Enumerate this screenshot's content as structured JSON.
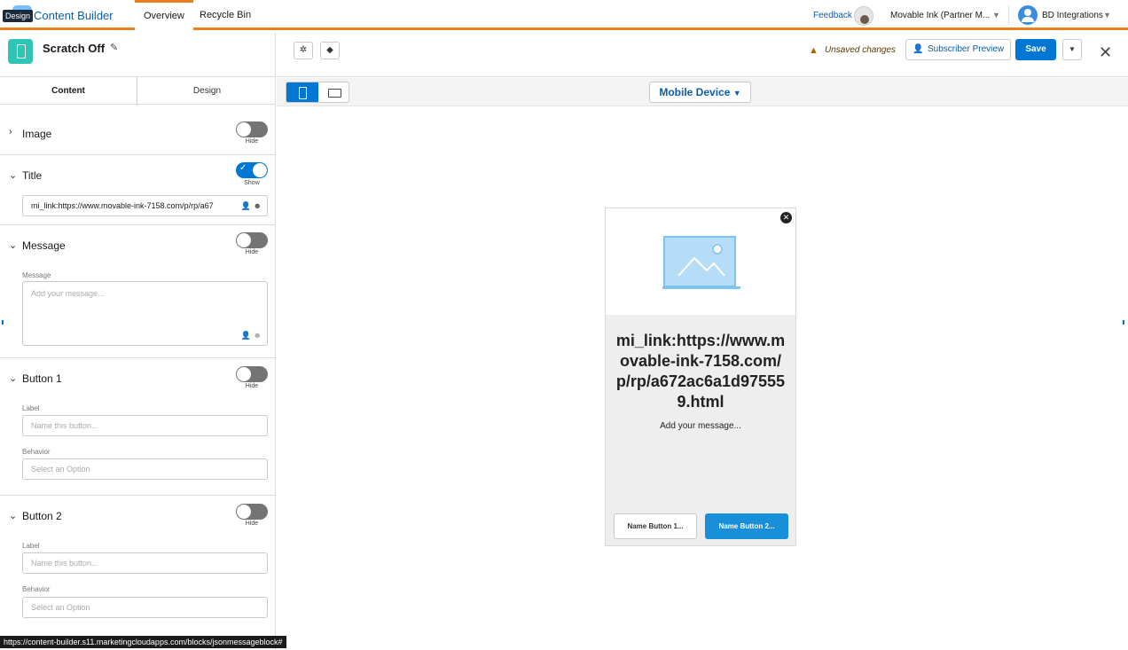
{
  "topnav": {
    "badge": "Design",
    "app_name": "Content Builder",
    "tabs": [
      {
        "label": "Overview",
        "active": true
      },
      {
        "label": "Recycle Bin",
        "active": false
      }
    ],
    "feedback": "Feedback",
    "account": "Movable Ink (Partner M...",
    "user": "BD Integrations"
  },
  "block": {
    "title": "Scratch Off"
  },
  "panel_tabs": {
    "content": "Content",
    "design": "Design"
  },
  "sections": {
    "image": {
      "label": "Image",
      "toggle": "Hide"
    },
    "title": {
      "label": "Title",
      "toggle": "Show",
      "value": "mi_link:https://www.movable-ink-7158.com/p/rp/a67"
    },
    "message": {
      "label": "Message",
      "toggle": "Hide",
      "field_label": "Message",
      "placeholder": "Add your message..."
    },
    "button1": {
      "label": "Button 1",
      "toggle": "Hide",
      "label_field": "Label",
      "label_placeholder": "Name this button...",
      "behavior_field": "Behavior",
      "behavior_placeholder": "Select an Option"
    },
    "button2": {
      "label": "Button 2",
      "toggle": "Hide",
      "label_field": "Label",
      "label_placeholder": "Name this button...",
      "behavior_field": "Behavior",
      "behavior_placeholder": "Select an Option"
    }
  },
  "toolbar": {
    "unsaved": "Unsaved changes",
    "subscriber_preview": "Subscriber Preview",
    "save": "Save"
  },
  "viewbar": {
    "device": "Mobile Device"
  },
  "preview": {
    "title": "mi_link:https://www.movable-ink-7158.com/p/rp/a672ac6a1d975559.html",
    "message": "Add your message...",
    "button1": "Name Button 1...",
    "button2": "Name Button 2..."
  },
  "status_url": "https://content-builder.s11.marketingcloudapps.com/blocks/jsonmessageblock#",
  "colors": {
    "accent": "#0176d3",
    "nav_border": "#e8801e",
    "block_icon": "#2ec4b6",
    "preview_button": "#1a8fd9"
  }
}
